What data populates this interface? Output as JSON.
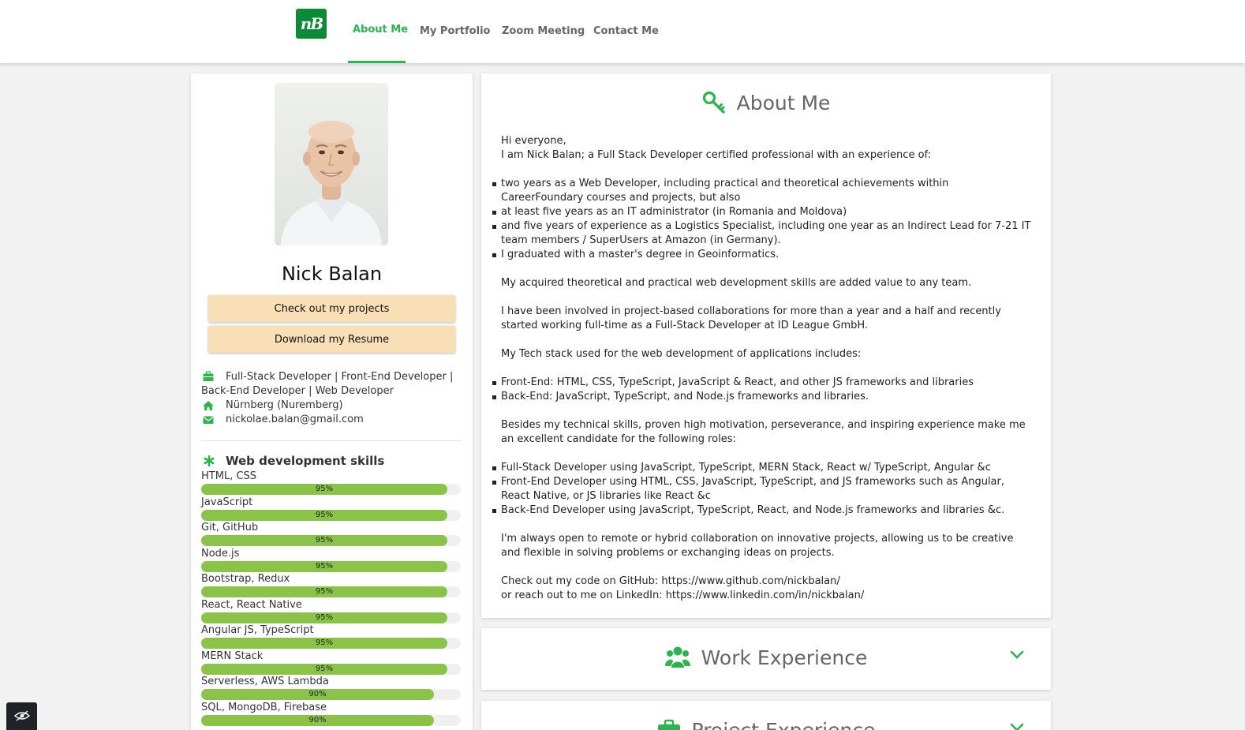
{
  "colors": {
    "brand_green": "#2fb34f",
    "logo_bg": "#0c8a35",
    "button_bg": "#f8dfb6",
    "skill_fill": "#8bc34a",
    "text_muted": "#666666"
  },
  "nav": {
    "logo_text": "nB",
    "items": [
      {
        "label": "About Me",
        "active": true
      },
      {
        "label": "My Portfolio",
        "active": false
      },
      {
        "label": "Zoom Meeting",
        "active": false
      },
      {
        "label": "Contact Me",
        "active": false
      }
    ]
  },
  "profile": {
    "name": "Nick Balan",
    "buttons": {
      "projects": "Check out my projects",
      "resume": "Download my Resume"
    },
    "info": {
      "title": {
        "icon": "briefcase-icon",
        "text": "Full-Stack Developer | Front-End Developer | Back-End Developer | Web Developer"
      },
      "location": {
        "icon": "home-icon",
        "text": "Nürnberg (Nuremberg)"
      },
      "email": {
        "icon": "envelope-icon",
        "text": "nickolae.balan@gmail.com"
      }
    },
    "skills_title": "Web development skills",
    "skills_icon": "asterisk-icon",
    "skills": [
      {
        "name": "HTML, CSS",
        "percent": 95,
        "label": "95%"
      },
      {
        "name": "JavaScript",
        "percent": 95,
        "label": "95%"
      },
      {
        "name": "Git, GitHub",
        "percent": 95,
        "label": "95%"
      },
      {
        "name": "Node.js",
        "percent": 95,
        "label": "95%"
      },
      {
        "name": "Bootstrap, Redux",
        "percent": 95,
        "label": "95%"
      },
      {
        "name": "React, React Native",
        "percent": 95,
        "label": "95%"
      },
      {
        "name": "Angular JS, TypeScript",
        "percent": 95,
        "label": "95%"
      },
      {
        "name": "MERN Stack",
        "percent": 95,
        "label": "95%"
      },
      {
        "name": "Serverless, AWS Lambda",
        "percent": 90,
        "label": "90%"
      },
      {
        "name": "SQL, MongoDB, Firebase",
        "percent": 90,
        "label": "90%"
      }
    ]
  },
  "about": {
    "heading": "About Me",
    "icon": "key-icon",
    "greeting": "Hi everyone,",
    "intro": "I am Nick Balan; a Full Stack Developer certified professional with an experience of:",
    "experience": [
      "two years as a Web Developer, including practical and theoretical achievements within CareerFoundary courses and projects, but also",
      "at least five years as an IT administrator (in Romania and Moldova)",
      "and five years of experience as a Logistics Specialist, including one year as an Indirect Lead for 7-21 IT team members / SuperUsers at Amazon (in Germany).",
      "I graduated with a master's degree in Geoinformatics."
    ],
    "value": "My acquired theoretical and practical web development skills are added value to any team.",
    "collab": "I have been involved in project-based collaborations for more than a year and a half and recently started working full-time as a Full-Stack Developer at ID League GmbH.",
    "stack_intro": "My Tech stack used for the web development of applications includes:",
    "stack": [
      "Front-End: HTML, CSS, TypeScript, JavaScript & React, and other JS frameworks and libraries",
      "Back-End: JavaScript, TypeScript, and Node.js frameworks and libraries."
    ],
    "roles_intro": "Besides my technical skills, proven high motivation, perseverance, and inspiring experience make me an excellent candidate for the following roles:",
    "roles": [
      "Full-Stack Developer using JavaScript, TypeScript, MERN Stack, React w/ TypeScript, Angular &c",
      "Front-End Developer using HTML, CSS, JavaScript, TypeScript, and JS frameworks such as Angular, React Native, or JS libraries like React &c",
      "Back-End Developer using JavaScript, TypeScript, React, and Node.js frameworks and libraries &c."
    ],
    "open": "I'm always open to remote or hybrid collaboration on innovative projects, allowing us to be creative and flexible in solving problems or exchanging ideas on projects.",
    "github_line": "Check out my code on GitHub: https://www.github.com/nickbalan/",
    "linkedin_line": "or reach out to me on LinkedIn: https://www.linkedin.com/in/nickbalan/"
  },
  "work": {
    "heading": "Work Experience",
    "icon": "users-icon",
    "toggle_icon": "chevron-down-icon"
  },
  "projects": {
    "heading": "Project Experience",
    "icon": "briefcase-icon",
    "toggle_icon": "chevron-down-icon"
  },
  "corner_widget": {
    "icon": "eye-slash-icon"
  }
}
